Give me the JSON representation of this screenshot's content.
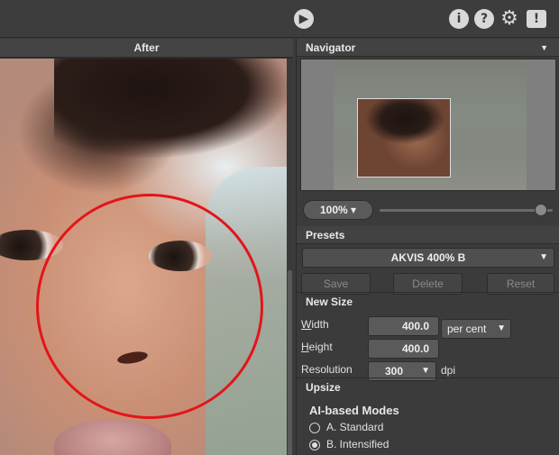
{
  "toolbar": {
    "icons": [
      "play-icon",
      "info-icon",
      "help-icon",
      "gear-icon",
      "feedback-icon"
    ]
  },
  "image_panel": {
    "header": "After"
  },
  "navigator": {
    "title": "Navigator",
    "zoom": "100%",
    "zoom_slider_level": 0.93
  },
  "presets": {
    "title": "Presets",
    "selected": "AKVIS 400% B",
    "save_label": "Save",
    "delete_label": "Delete",
    "reset_label": "Reset"
  },
  "new_size": {
    "title": "New Size",
    "width_label_u": "W",
    "width_label_rest": "idth",
    "width_value": "400.0",
    "height_label_u": "H",
    "height_label_rest": "eight",
    "height_value": "400.0",
    "unit": "per cent",
    "resolution_label": "Resolution",
    "resolution_value": "300",
    "resolution_unit": "dpi"
  },
  "upsize": {
    "title": "Upsize",
    "modes_title": "AI-based Modes",
    "mode_a": "A. Standard",
    "mode_b": "B. Intensified",
    "selected_mode": "B. Intensified"
  },
  "colors": {
    "circle": "#e3151a",
    "panel_bg": "#3b3b3b"
  }
}
